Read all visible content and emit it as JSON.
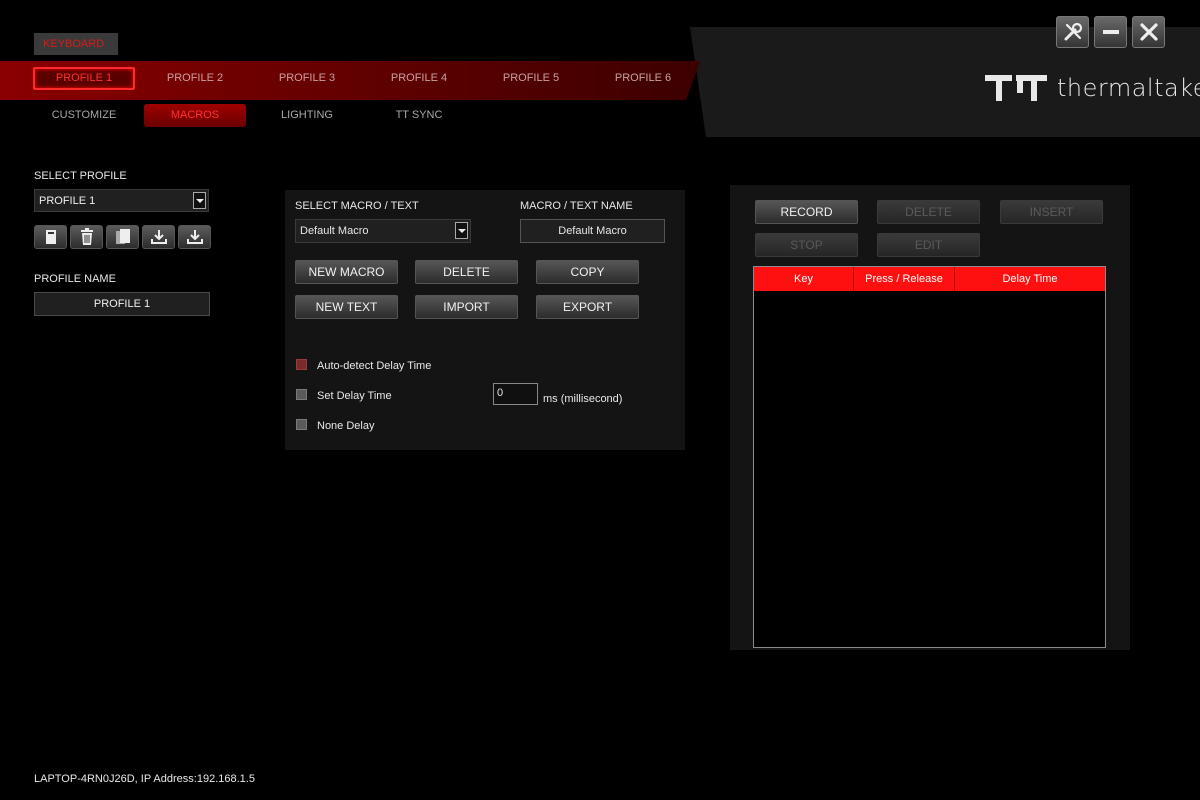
{
  "device_tab": "KEYBOARD",
  "profile_tabs": [
    "PROFILE 1",
    "PROFILE 2",
    "PROFILE 3",
    "PROFILE 4",
    "PROFILE 5",
    "PROFILE 6"
  ],
  "sub_tabs": [
    "CUSTOMIZE",
    "MACROS",
    "LIGHTING",
    "TT SYNC"
  ],
  "brand": {
    "name": "thermaltake",
    "accent": "#ff1010"
  },
  "icons": {
    "window_controls": [
      "settings-tools-icon",
      "minimize-icon",
      "close-icon"
    ],
    "profile_actions": [
      "new-profile-icon",
      "delete-profile-icon",
      "copy-profile-icon",
      "import-profile-icon",
      "export-profile-icon"
    ]
  },
  "left": {
    "select_profile_label": "SELECT PROFILE",
    "select_profile_value": "PROFILE 1",
    "profile_name_label": "PROFILE NAME",
    "profile_name_value": "PROFILE 1"
  },
  "macro": {
    "select_label": "SELECT MACRO / TEXT",
    "select_value": "Default Macro",
    "name_label": "MACRO / TEXT NAME",
    "name_value": "Default Macro",
    "buttons": [
      "NEW MACRO",
      "DELETE",
      "COPY",
      "NEW TEXT",
      "IMPORT",
      "EXPORT"
    ],
    "options": [
      "Auto-detect Delay Time",
      "Set Delay Time",
      "None Delay"
    ],
    "delay_value": "0",
    "delay_unit": "ms (millisecond)"
  },
  "recorder": {
    "buttons": [
      "RECORD",
      "DELETE",
      "INSERT",
      "STOP",
      "EDIT"
    ],
    "columns": [
      "Key",
      "Press / Release",
      "Delay Time"
    ]
  },
  "footer": "LAPTOP-4RN0J26D, IP Address:192.168.1.5"
}
